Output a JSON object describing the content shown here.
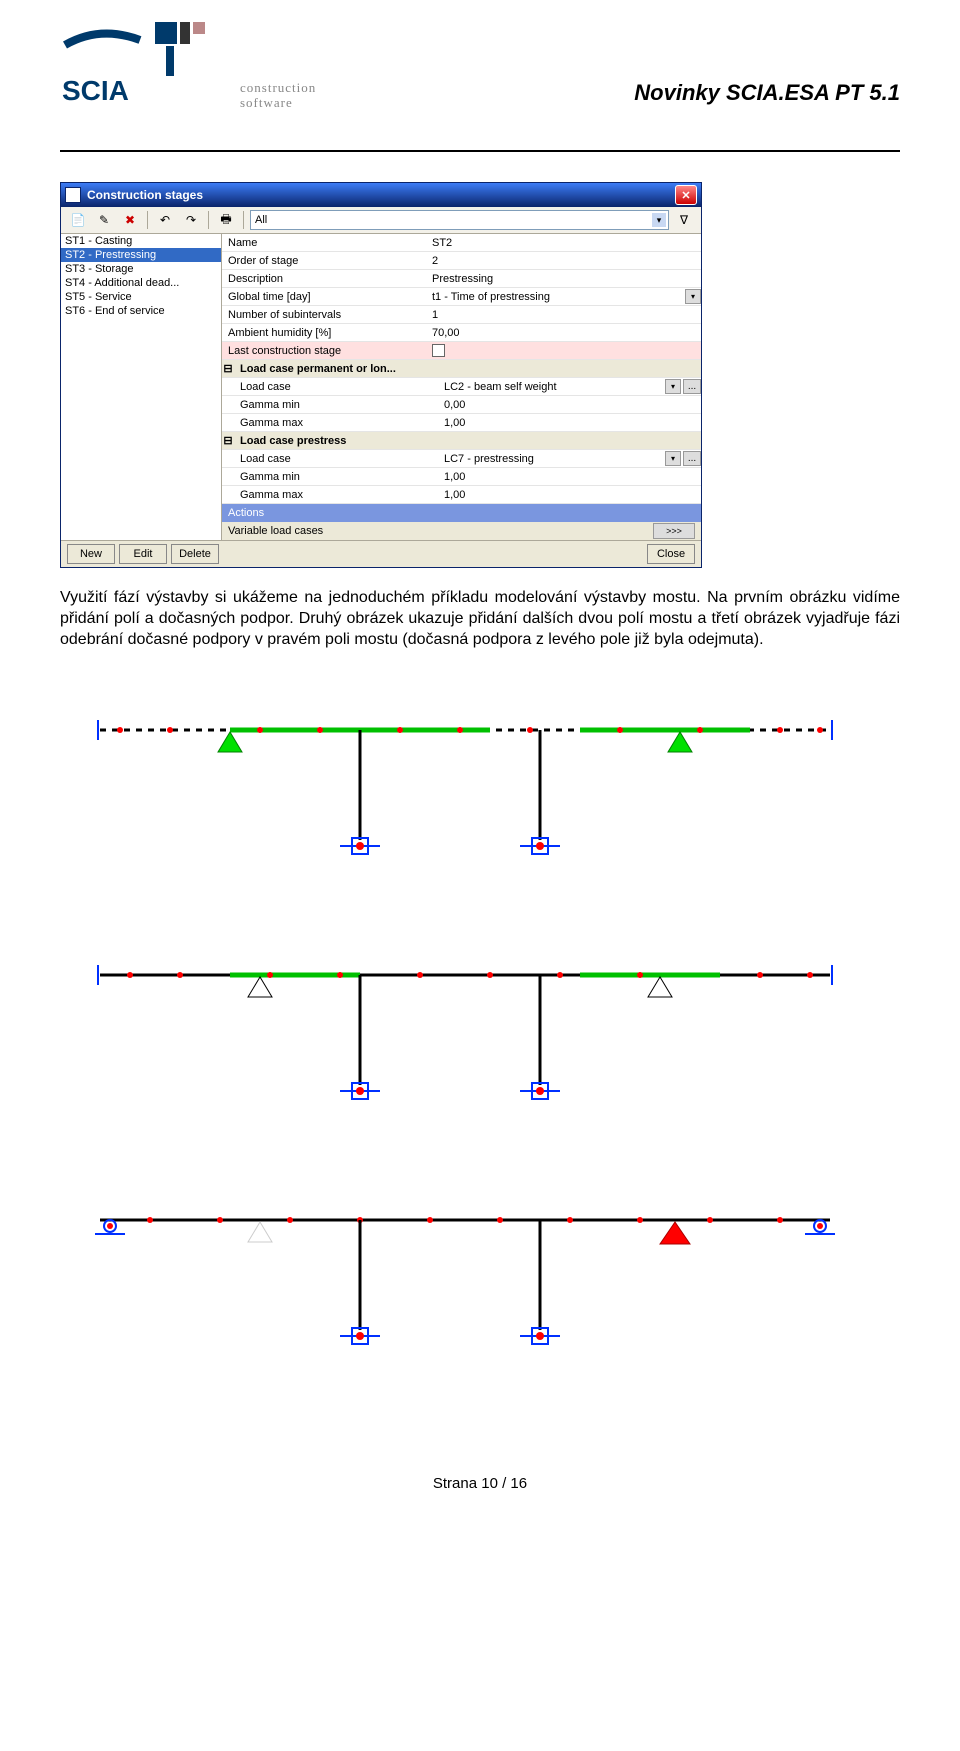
{
  "header": {
    "logo_lines": [
      "construction",
      "software"
    ],
    "doc_title": "Novinky SCIA.ESA PT 5.1"
  },
  "dialog": {
    "title": "Construction stages",
    "toolbar_filter": "All",
    "stages": [
      "ST1 - Casting",
      "ST2 - Prestressing",
      "ST3 - Storage",
      "ST4 - Additional dead...",
      "ST5 - Service",
      "ST6 - End of service"
    ],
    "selected_index": 1,
    "props": [
      {
        "label": "Name",
        "value": "ST2"
      },
      {
        "label": "Order of stage",
        "value": "2"
      },
      {
        "label": "Description",
        "value": "Prestressing"
      },
      {
        "label": "Global time [day]",
        "value": "t1 - Time of prestressing",
        "combo": true
      },
      {
        "label": "Number of subintervals",
        "value": "1"
      },
      {
        "label": "Ambient humidity [%]",
        "value": "70,00"
      },
      {
        "label": "Last construction stage",
        "value": "",
        "checkbox": true,
        "shade": true
      }
    ],
    "group1": "Load case permanent or lon...",
    "group1_props": [
      {
        "label": "Load case",
        "value": "LC2 - beam self weight",
        "combo": true,
        "dots": true
      },
      {
        "label": "Gamma min",
        "value": "0,00"
      },
      {
        "label": "Gamma max",
        "value": "1,00"
      }
    ],
    "group2": "Load case prestress",
    "group2_props": [
      {
        "label": "Load case",
        "value": "LC7 - prestressing",
        "combo": true,
        "dots": true
      },
      {
        "label": "Gamma min",
        "value": "1,00"
      },
      {
        "label": "Gamma max",
        "value": "1,00"
      }
    ],
    "actions_header": "Actions",
    "actions_row": "Variable load cases",
    "actions_btn": ">>>",
    "buttons": {
      "new": "New",
      "edit": "Edit",
      "delete": "Delete",
      "close": "Close"
    }
  },
  "paragraph": "Využití fází výstavby si ukážeme na jednoduchém příkladu modelování výstavby mostu. Na prvním obrázku vidíme přidání polí a dočasných podpor. Druhý obrázek ukazuje přidání dalších dvou polí mostu a třetí obrázek vyjadřuje fázi odebrání dočasné podpory v pravém poli mostu (dočasná podpora z levého pole již byla odejmuta).",
  "footer": "Strana 10 / 16"
}
